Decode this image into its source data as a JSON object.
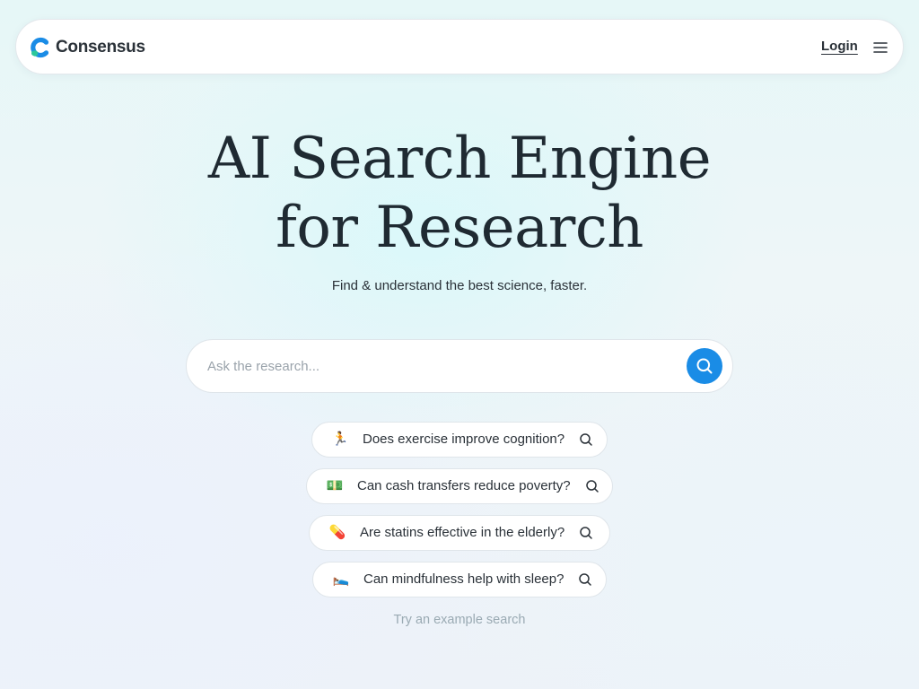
{
  "header": {
    "brand_name": "Consensus",
    "login_label": "Login",
    "brand_colors": {
      "blue": "#1a8ce6",
      "green": "#2cc79a"
    }
  },
  "hero": {
    "title_line1": "AI Search Engine",
    "title_line2": "for Research",
    "subtitle": "Find & understand the best science, faster."
  },
  "search": {
    "placeholder": "Ask the research...",
    "value": "",
    "button_icon": "search-icon",
    "accent": "#1a8ce6"
  },
  "examples": [
    {
      "emoji": "🏃",
      "text": "Does exercise improve cognition?"
    },
    {
      "emoji": "💵",
      "text": "Can cash transfers reduce poverty?"
    },
    {
      "emoji": "💊",
      "text": "Are statins effective in the elderly?"
    },
    {
      "emoji": "🛌",
      "text": "Can mindfulness help with sleep?"
    }
  ],
  "try_example_label": "Try an example search"
}
